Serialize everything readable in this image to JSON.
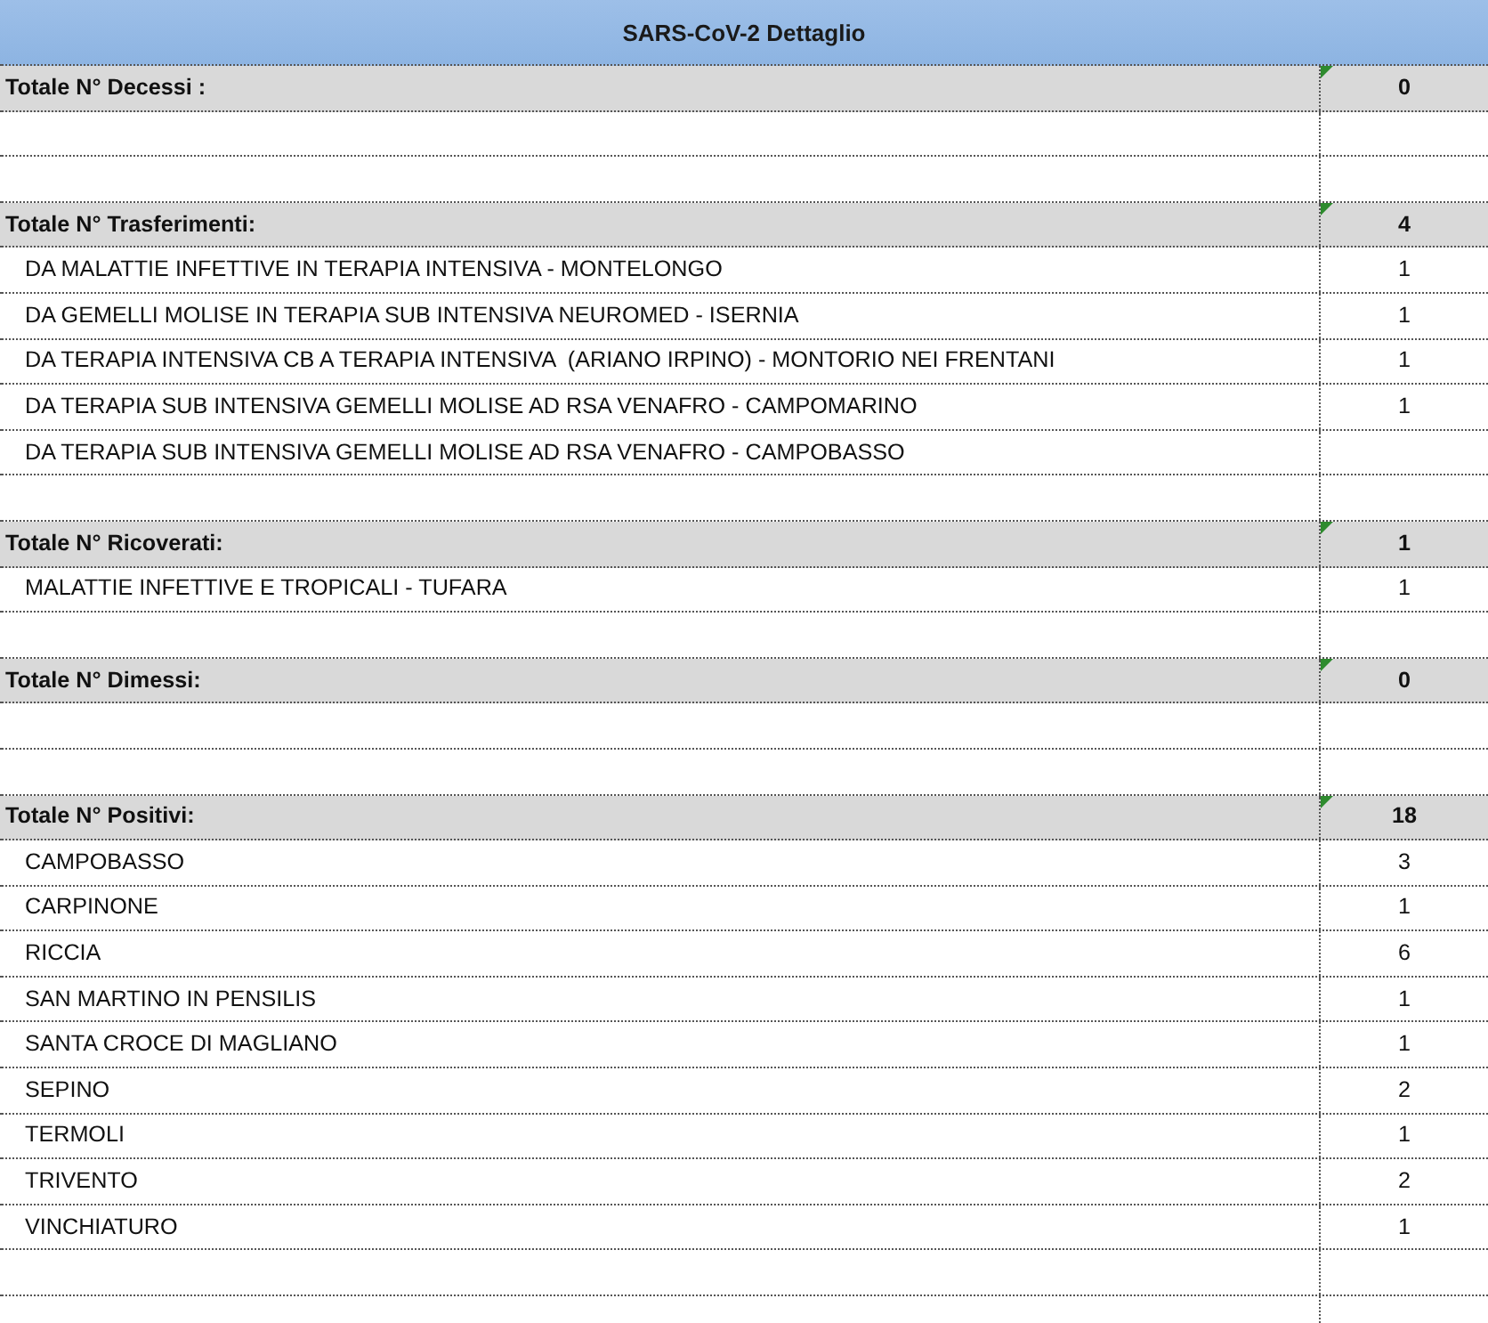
{
  "title": "SARS-CoV-2 Dettaglio",
  "rows": [
    {
      "kind": "total",
      "label": "Totale N° Decessi :",
      "value": "0"
    },
    {
      "kind": "blank"
    },
    {
      "kind": "blank"
    },
    {
      "kind": "total",
      "label": "Totale N° Trasferimenti:",
      "value": "4"
    },
    {
      "kind": "item",
      "label": "DA MALATTIE INFETTIVE IN TERAPIA INTENSIVA - MONTELONGO",
      "value": "1"
    },
    {
      "kind": "item",
      "label": "DA GEMELLI MOLISE IN TERAPIA SUB INTENSIVA NEUROMED - ISERNIA",
      "value": "1"
    },
    {
      "kind": "item",
      "label": "DA TERAPIA INTENSIVA CB A TERAPIA INTENSIVA  (ARIANO IRPINO) - MONTORIO NEI FRENTANI",
      "value": "1"
    },
    {
      "kind": "item",
      "label": "DA TERAPIA SUB INTENSIVA GEMELLI MOLISE AD RSA VENAFRO - CAMPOMARINO",
      "value": "1"
    },
    {
      "kind": "item",
      "label": "DA TERAPIA SUB INTENSIVA GEMELLI MOLISE AD RSA VENAFRO - CAMPOBASSO"
    },
    {
      "kind": "blank"
    },
    {
      "kind": "total",
      "label": "Totale N° Ricoverati:",
      "value": "1"
    },
    {
      "kind": "item",
      "label": "MALATTIE INFETTIVE E TROPICALI - TUFARA",
      "value": "1"
    },
    {
      "kind": "blank"
    },
    {
      "kind": "total",
      "label": "Totale N° Dimessi:",
      "value": "0"
    },
    {
      "kind": "blank"
    },
    {
      "kind": "blank"
    },
    {
      "kind": "total",
      "label": "Totale N° Positivi:",
      "value": "18"
    },
    {
      "kind": "item",
      "label": "CAMPOBASSO",
      "value": "3"
    },
    {
      "kind": "item",
      "label": "CARPINONE",
      "value": "1"
    },
    {
      "kind": "item",
      "label": "RICCIA",
      "value": "6"
    },
    {
      "kind": "item",
      "label": "SAN MARTINO IN PENSILIS",
      "value": "1"
    },
    {
      "kind": "item",
      "label": "SANTA CROCE DI MAGLIANO",
      "value": "1"
    },
    {
      "kind": "item",
      "label": "SEPINO",
      "value": "2"
    },
    {
      "kind": "item",
      "label": "TERMOLI",
      "value": "1"
    },
    {
      "kind": "item",
      "label": "TRIVENTO",
      "value": "2"
    },
    {
      "kind": "item",
      "label": "VINCHIATURO",
      "value": "1"
    },
    {
      "kind": "blank"
    },
    {
      "kind": "blank"
    }
  ]
}
